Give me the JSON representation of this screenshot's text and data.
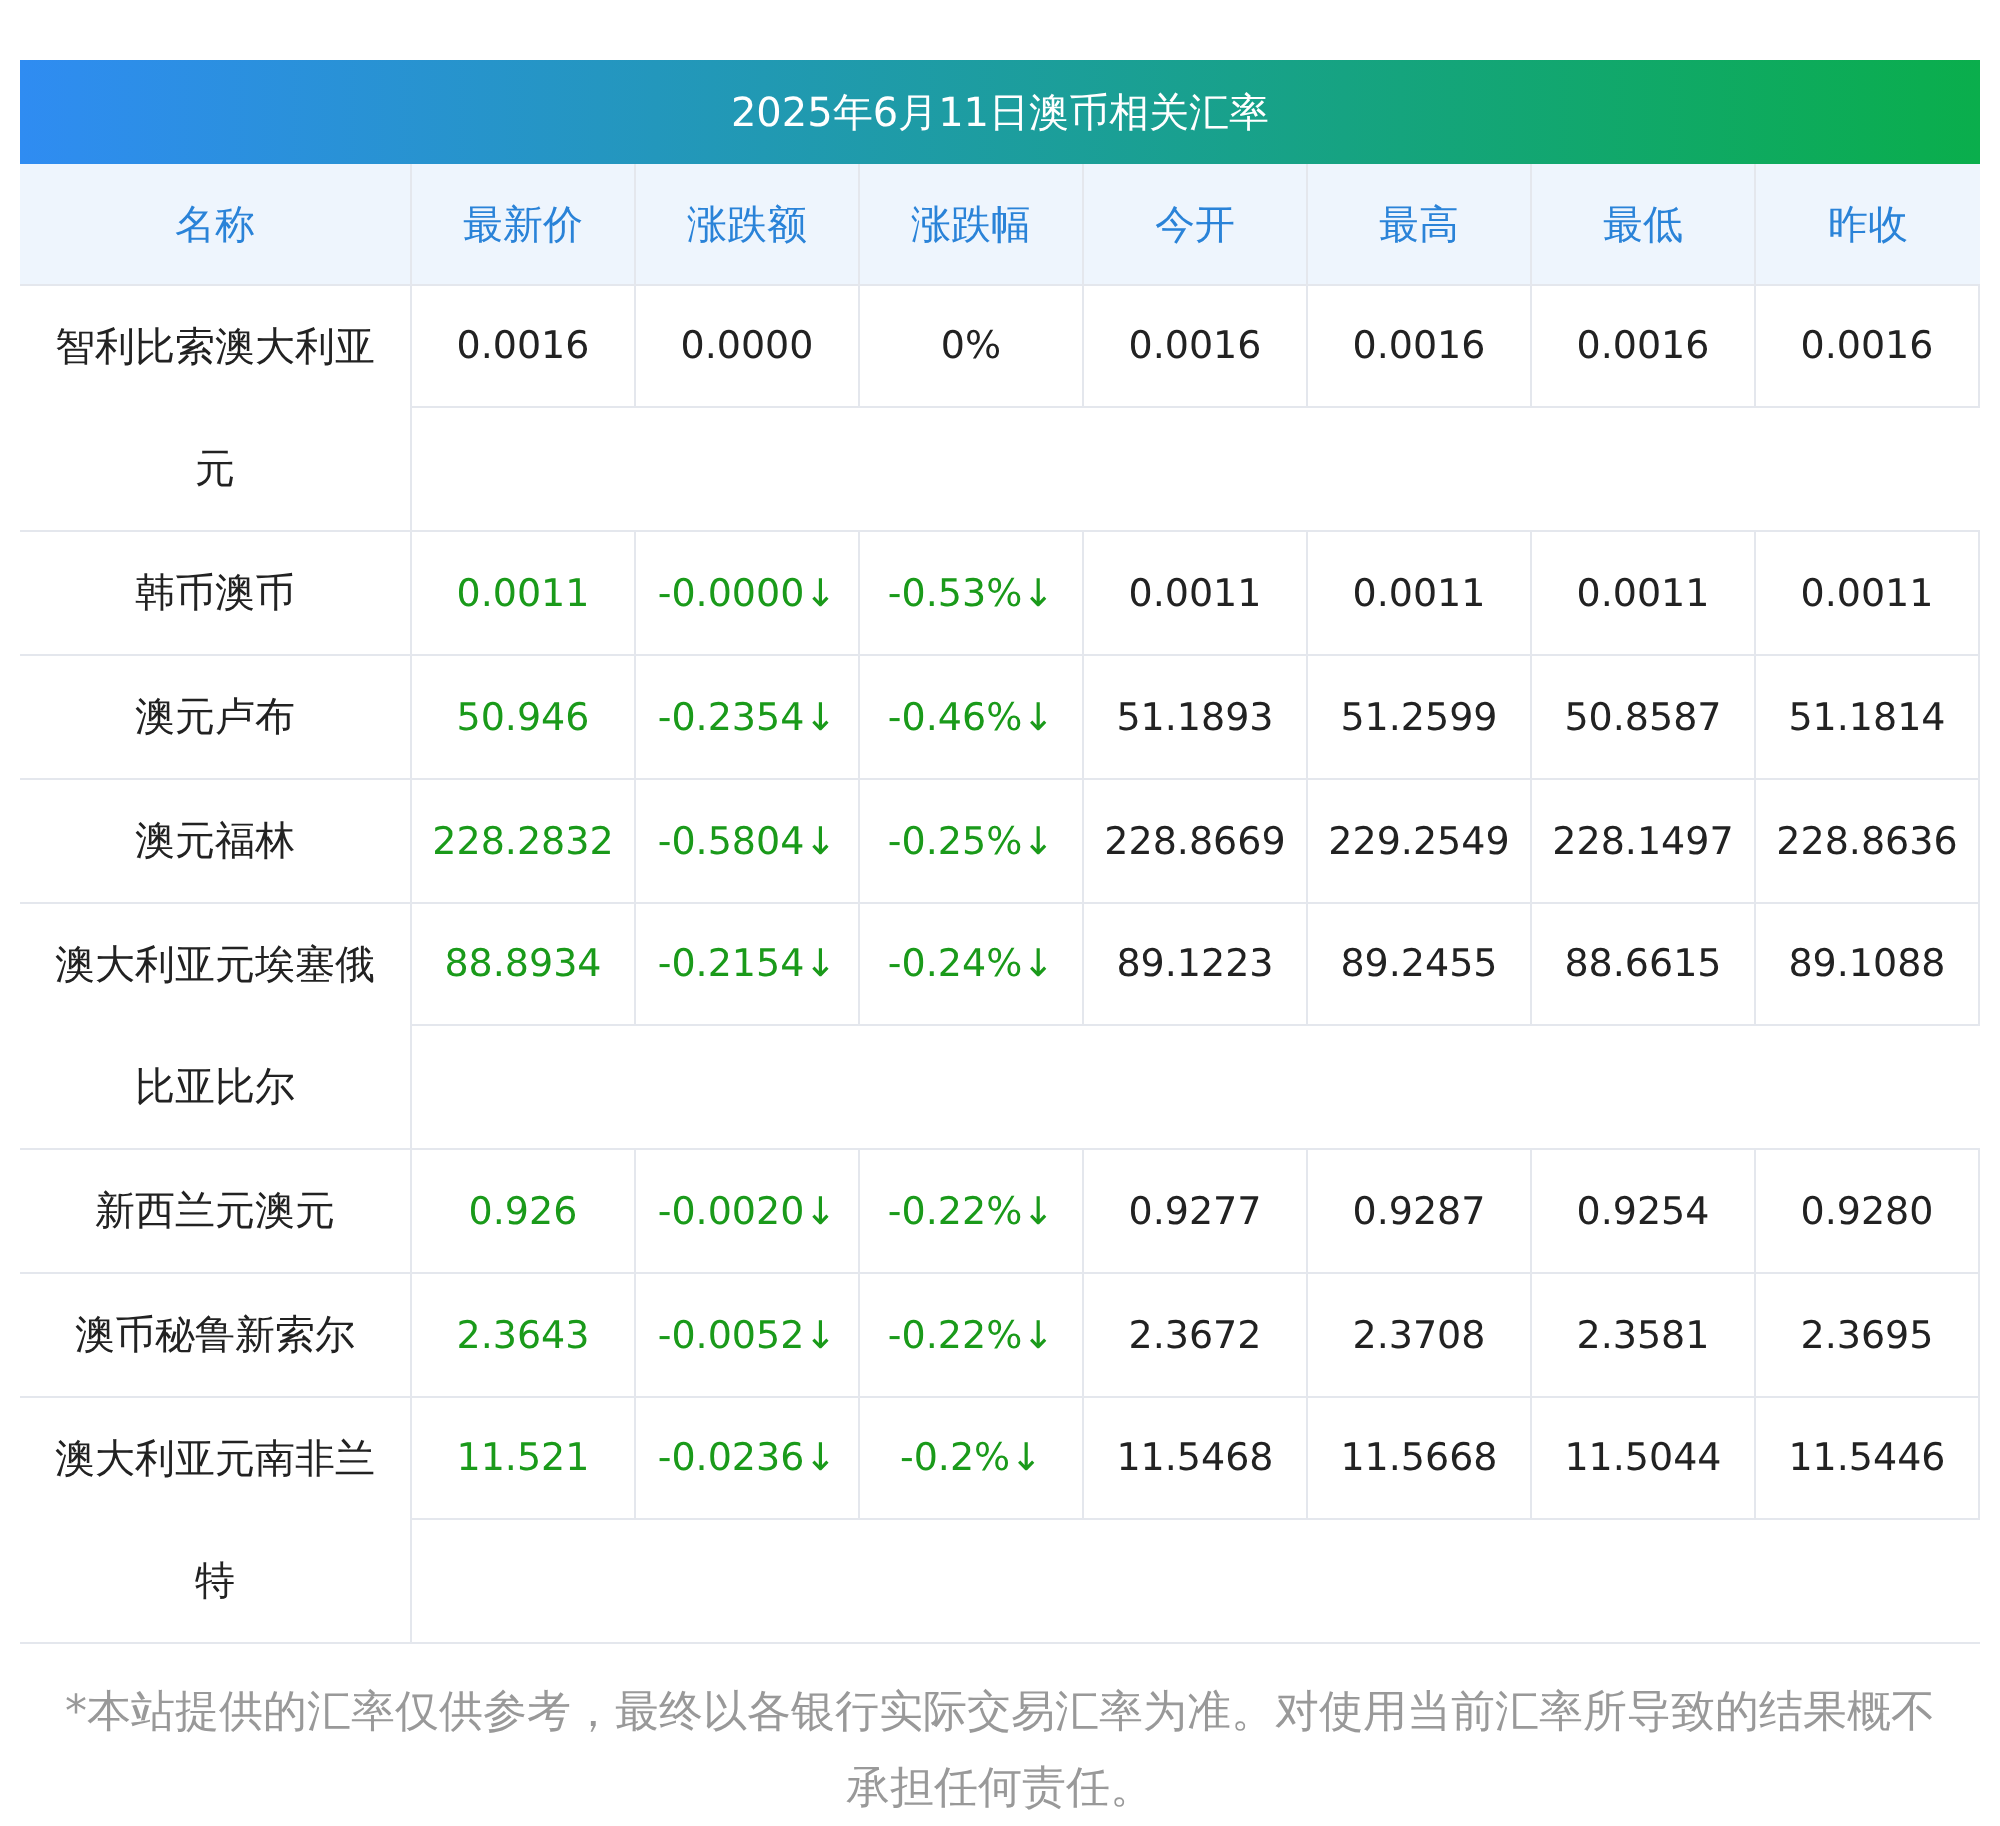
{
  "title": "2025年6月11日澳币相关汇率",
  "columns": [
    "名称",
    "最新价",
    "涨跌额",
    "涨跌幅",
    "今开",
    "最高",
    "最低",
    "昨收"
  ],
  "rows": [
    {
      "name": "智利比索澳大利亚元",
      "color": "#222222",
      "latest": "0.0016",
      "change": "0.0000",
      "change_pct": "0%",
      "open": "0.0016",
      "high": "0.0016",
      "low": "0.0016",
      "prev_close": "0.0016"
    },
    {
      "name": "韩币澳币",
      "color": "#1a9a1a",
      "latest": "0.0011",
      "change": "-0.0000↓",
      "change_pct": "-0.53%↓",
      "open": "0.0011",
      "high": "0.0011",
      "low": "0.0011",
      "prev_close": "0.0011"
    },
    {
      "name": "澳元卢布",
      "color": "#1a9a1a",
      "latest": "50.946",
      "change": "-0.2354↓",
      "change_pct": "-0.46%↓",
      "open": "51.1893",
      "high": "51.2599",
      "low": "50.8587",
      "prev_close": "51.1814"
    },
    {
      "name": "澳元福林",
      "color": "#1a9a1a",
      "latest": "228.2832",
      "change": "-0.5804↓",
      "change_pct": "-0.25%↓",
      "open": "228.8669",
      "high": "229.2549",
      "low": "228.1497",
      "prev_close": "228.8636"
    },
    {
      "name": "澳大利亚元埃塞俄比亚比尔",
      "color": "#1a9a1a",
      "latest": "88.8934",
      "change": "-0.2154↓",
      "change_pct": "-0.24%↓",
      "open": "89.1223",
      "high": "89.2455",
      "low": "88.6615",
      "prev_close": "89.1088"
    },
    {
      "name": "新西兰元澳元",
      "color": "#1a9a1a",
      "latest": "0.926",
      "change": "-0.0020↓",
      "change_pct": "-0.22%↓",
      "open": "0.9277",
      "high": "0.9287",
      "low": "0.9254",
      "prev_close": "0.9280"
    },
    {
      "name": "澳币秘鲁新索尔",
      "color": "#1a9a1a",
      "latest": "2.3643",
      "change": "-0.0052↓",
      "change_pct": "-0.22%↓",
      "open": "2.3672",
      "high": "2.3708",
      "low": "2.3581",
      "prev_close": "2.3695"
    },
    {
      "name": "澳大利亚元南非兰特",
      "color": "#1a9a1a",
      "latest": "11.521",
      "change": "-0.0236↓",
      "change_pct": "-0.2%↓",
      "open": "11.5468",
      "high": "11.5668",
      "low": "11.5044",
      "prev_close": "11.5446"
    }
  ],
  "disclaimer": "*本站提供的汇率仅供参考，最终以各银行实际交易汇率为准。对使用当前汇率所导致的结果概不承担任何责任。"
}
